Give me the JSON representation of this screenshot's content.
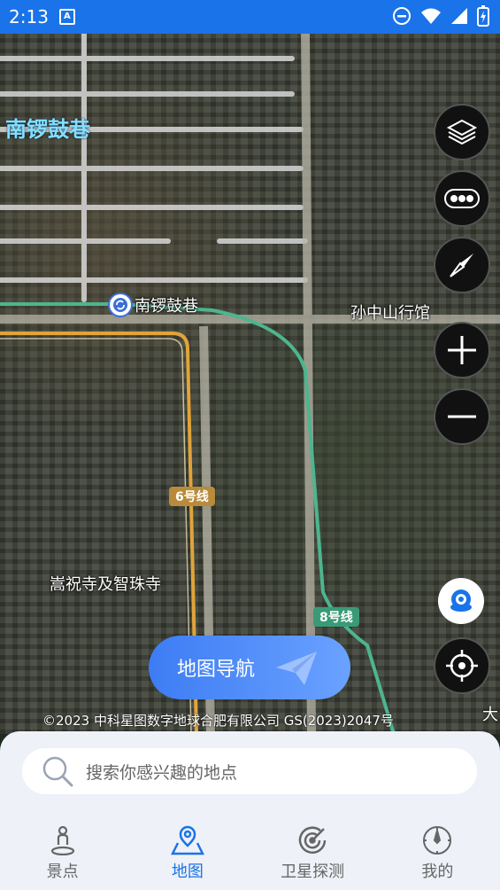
{
  "status": {
    "time": "2:13",
    "notif_glyph": "A"
  },
  "map": {
    "district_label": "南锣鼓巷",
    "station_label": "南锣鼓巷",
    "poi_1": "孙中山行馆",
    "poi_2": "嵩祝寺及智珠寺",
    "line_6": "6号线",
    "line_8": "8号线",
    "line_6_color": "#c9a24a",
    "line_8_color": "#3a9a78",
    "copyright": "©2023 中科星图数字地球合肥有限公司 GS(2023)2047号",
    "edge_char": "大"
  },
  "controls": {
    "layers_icon": "layers-icon",
    "traffic_icon": "traffic-icon",
    "compass_icon": "compass-icon",
    "zoom_in_icon": "plus-icon",
    "zoom_out_icon": "minus-icon",
    "camera_icon": "camera-icon",
    "locate_icon": "locate-icon"
  },
  "nav_button": {
    "label": "地图导航"
  },
  "search": {
    "placeholder": "搜索你感兴趣的地点"
  },
  "tabs": [
    {
      "label": "景点",
      "icon": "person-icon"
    },
    {
      "label": "地图",
      "icon": "map-pin-icon"
    },
    {
      "label": "卫星探测",
      "icon": "radar-icon"
    },
    {
      "label": "我的",
      "icon": "compass-dial-icon"
    }
  ],
  "colors": {
    "accent": "#1a73e8",
    "statusbar": "#1a73e8"
  }
}
